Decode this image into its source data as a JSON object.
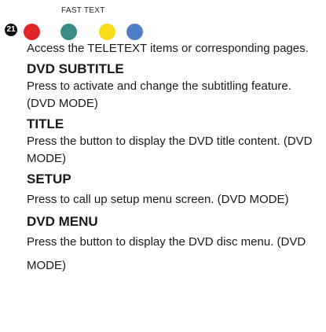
{
  "fast_text": {
    "label": "FAST TEXT",
    "badge": "21",
    "buttons": [
      {
        "name": "red",
        "color": "#e0262b"
      },
      {
        "name": "green",
        "color": "#3a8c86"
      },
      {
        "name": "yellow",
        "color": "#f7dc18"
      },
      {
        "name": "blue",
        "color": "#4f7ec8"
      }
    ],
    "description": "Access the TELETEXT items or corresponding pages."
  },
  "sections": {
    "dvd_subtitle": {
      "heading": "DVD SUBTITLE",
      "description": "Press to activate and change the subtitling feature.(DVD MODE)"
    },
    "title": {
      "heading": "TITLE",
      "description": "Press the button to display the DVD title content. (DVD MODE)"
    },
    "setup": {
      "heading": "SETUP",
      "description": "Press to call up setup menu screen. (DVD MODE)"
    },
    "dvd_menu": {
      "heading": "DVD MENU",
      "description": "Press the button to display the DVD disc menu. (DVD MODE)"
    }
  }
}
